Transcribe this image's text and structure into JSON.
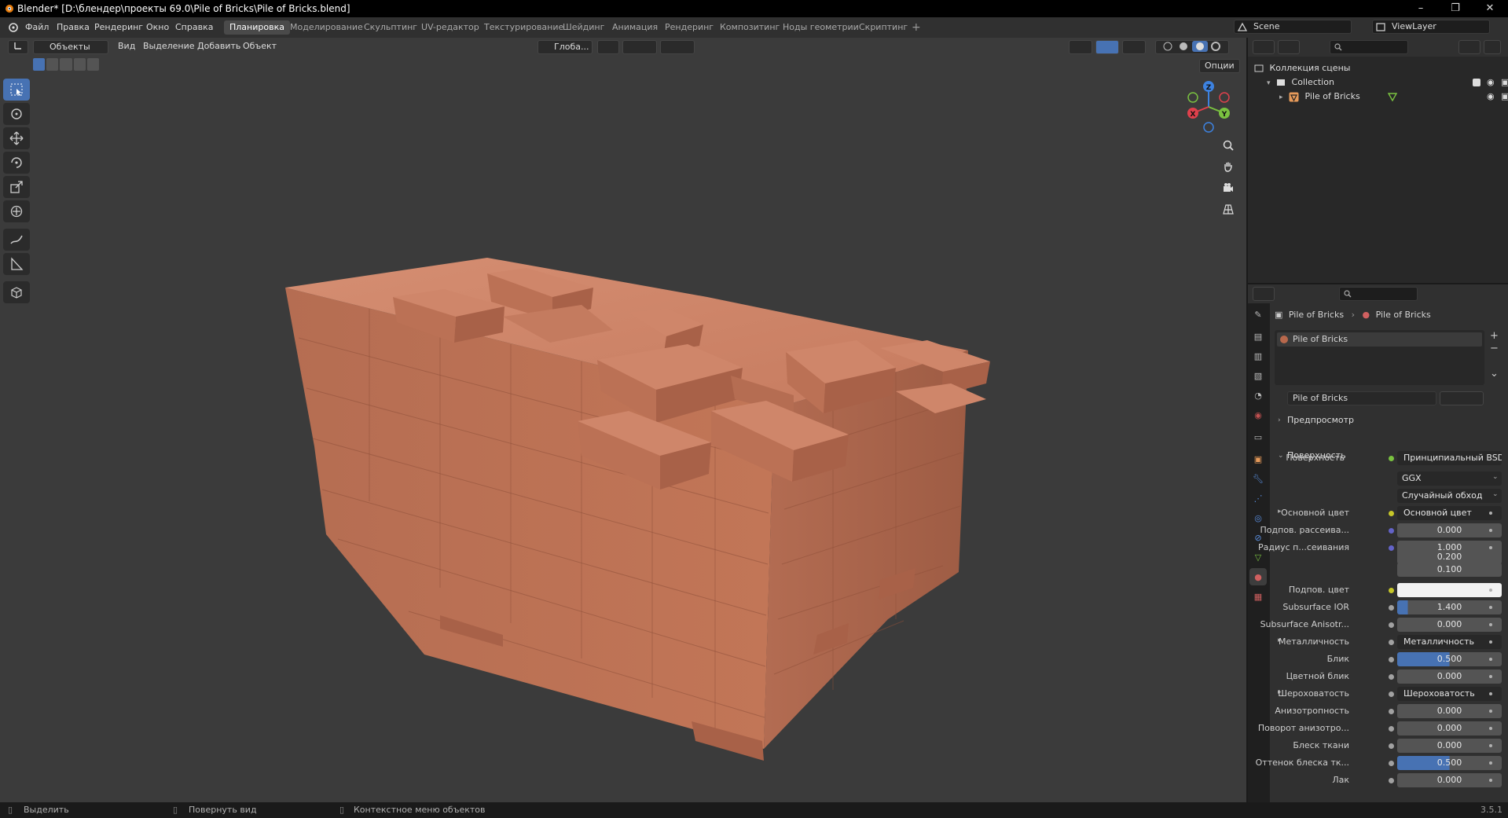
{
  "titlebar": {
    "title": "Blender* [D:\\блендер\\проекты 69.0\\Pile of Bricks\\Pile of Bricks.blend]",
    "minimize": "–",
    "restore": "❐",
    "close": "✕"
  },
  "topmenu": {
    "items": [
      "Файл",
      "Правка",
      "Рендеринг",
      "Окно",
      "Справка"
    ]
  },
  "workspaces": {
    "tabs": [
      "Планировка",
      "Моделирование",
      "Скульптинг",
      "UV-редактор",
      "Текстурирование",
      "Шейдинг",
      "Анимация",
      "Рендеринг",
      "Композитинг",
      "Ноды геометрии",
      "Скриптинг"
    ],
    "active": "Планировка",
    "add": "+"
  },
  "scene": {
    "label": "Scene"
  },
  "viewlayer": {
    "label": "ViewLayer"
  },
  "viewport_header": {
    "mode": "Объекты",
    "menus": [
      "Вид",
      "Выделение",
      "Добавить",
      "Объект"
    ],
    "orientation": "Глоба...",
    "options": "Опции"
  },
  "gizmo": {
    "x": "X",
    "y": "Y",
    "z": "Z"
  },
  "outliner": {
    "scene_collection": "Коллекция сцены",
    "collection": "Collection",
    "object": "Pile of Bricks"
  },
  "properties": {
    "breadcrumb_object": "Pile of Bricks",
    "breadcrumb_material": "Pile of Bricks",
    "material_slot": "Pile of Bricks",
    "material_name": "Pile of Bricks",
    "sections": {
      "preview": "Предпросмотр",
      "surface": "Поверхность"
    },
    "surface_label": "Поверхность",
    "surface_value": "Принципиальный BSDF",
    "distribution": "GGX",
    "subsurface_method": "Случайный обход",
    "rows": [
      {
        "label": "Основной цвет",
        "value": "Основной цвет",
        "kind": "link",
        "sock": "#c7c729",
        "expand": true
      },
      {
        "label": "Подпов. рассеива...",
        "value": "0.000",
        "kind": "num",
        "sock": "#6363c7"
      },
      {
        "label": "Радиус п...сеивания",
        "value": "1.000",
        "kind": "vec",
        "sock": "#6363c7"
      },
      {
        "label": "",
        "value": "0.200",
        "kind": "vec2"
      },
      {
        "label": "",
        "value": "0.100",
        "kind": "vec2"
      },
      {
        "label": "Подпов. цвет",
        "value": "",
        "kind": "color",
        "sock": "#c7c729"
      },
      {
        "label": "Subsurface IOR",
        "value": "1.400",
        "kind": "blue",
        "fill": "0.1",
        "sock": "#a1a1a1"
      },
      {
        "label": "Subsurface Anisotr...",
        "value": "0.000",
        "kind": "num",
        "sock": "#a1a1a1"
      },
      {
        "label": "Металличность",
        "value": "Металличность",
        "kind": "link",
        "sock": "#a1a1a1",
        "expand": true
      },
      {
        "label": "Блик",
        "value": "0.500",
        "kind": "blue",
        "fill": "0.5",
        "sock": "#a1a1a1"
      },
      {
        "label": "Цветной блик",
        "value": "0.000",
        "kind": "num",
        "sock": "#a1a1a1"
      },
      {
        "label": "Шероховатость",
        "value": "Шероховатость",
        "kind": "link",
        "sock": "#a1a1a1",
        "expand": true
      },
      {
        "label": "Анизотропность",
        "value": "0.000",
        "kind": "num",
        "sock": "#a1a1a1"
      },
      {
        "label": "Поворот анизотро...",
        "value": "0.000",
        "kind": "num",
        "sock": "#a1a1a1"
      },
      {
        "label": "Блеск ткани",
        "value": "0.000",
        "kind": "num",
        "sock": "#a1a1a1"
      },
      {
        "label": "Оттенок блеска тк...",
        "value": "0.500",
        "kind": "blue",
        "fill": "0.5",
        "sock": "#a1a1a1"
      },
      {
        "label": "Лак",
        "value": "0.000",
        "kind": "num",
        "sock": "#a1a1a1"
      }
    ]
  },
  "statusbar": {
    "select": "Выделить",
    "rotate": "Повернуть вид",
    "context": "Контекстное меню объектов",
    "version": "3.5.1"
  },
  "colors": {
    "accent": "#4772b3",
    "header": "#303030",
    "viewport": "#3b3b3b",
    "brick": "#c0775a"
  }
}
